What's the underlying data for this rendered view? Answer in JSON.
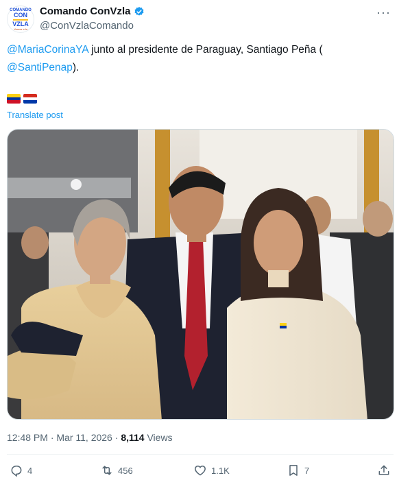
{
  "author": {
    "display_name": "Comando ConVzla",
    "handle": "@ConVzlaComando",
    "avatar_text": {
      "top": "COMANDO",
      "mid": "CON",
      "bot": "VZLA",
      "sub": "Vamos a la"
    }
  },
  "tweet": {
    "mention1": "@MariaCorinaYA",
    "text1": " junto al presidente de Paraguay, Santiago Peña (",
    "mention2": "@SantiPenap",
    "text2": ")."
  },
  "flags": [
    "venezuela-flag",
    "paraguay-flag"
  ],
  "translate_label": "Translate post",
  "meta": {
    "time": "12:48 PM",
    "separator1": " · ",
    "date": "Mar 11, 2026",
    "separator2": " · ",
    "views": "8,114",
    "views_label": " Views"
  },
  "actions": {
    "replies": "4",
    "reposts": "456",
    "likes": "1.1K",
    "bookmarks": "7"
  },
  "colors": {
    "accent": "#1d9bf0",
    "text": "#0f1419",
    "muted": "#536471"
  }
}
